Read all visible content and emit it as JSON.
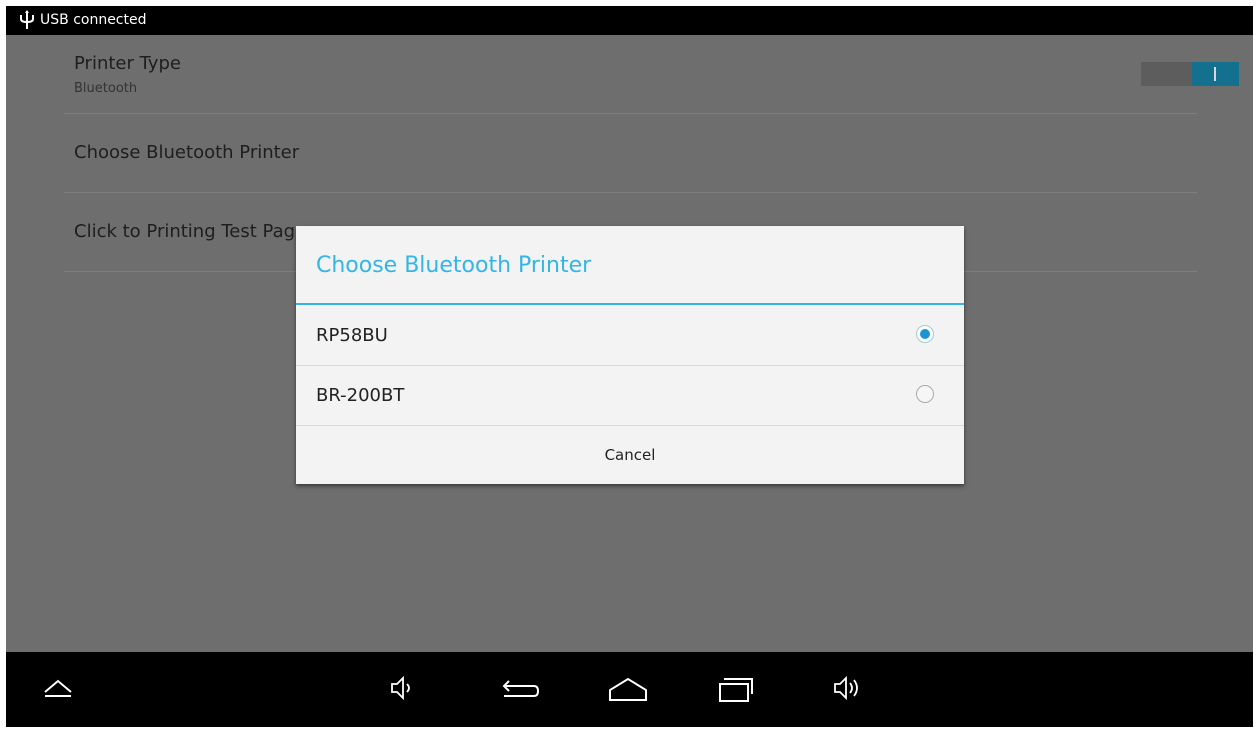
{
  "status_bar": {
    "text": "USB connected",
    "icon": "usb-icon"
  },
  "settings": {
    "printer_type": {
      "title": "Printer Type",
      "subtitle": "Bluetooth",
      "toggle_on": true
    },
    "choose_printer": {
      "title": "Choose Bluetooth Printer"
    },
    "test_page": {
      "title": "Click to Printing Test Page"
    }
  },
  "dialog": {
    "title": "Choose Bluetooth Printer",
    "options": [
      {
        "label": "RP58BU",
        "selected": true
      },
      {
        "label": "BR-200BT",
        "selected": false
      }
    ],
    "cancel_label": "Cancel"
  },
  "nav_bar": {
    "icons": [
      "up-arrow-icon",
      "volume-down-icon",
      "back-icon",
      "home-icon",
      "recent-apps-icon",
      "volume-up-icon"
    ]
  },
  "colors": {
    "accent": "#33b5e5",
    "toggle_on": "#14708f",
    "radio_selected": "#1b95d3"
  }
}
